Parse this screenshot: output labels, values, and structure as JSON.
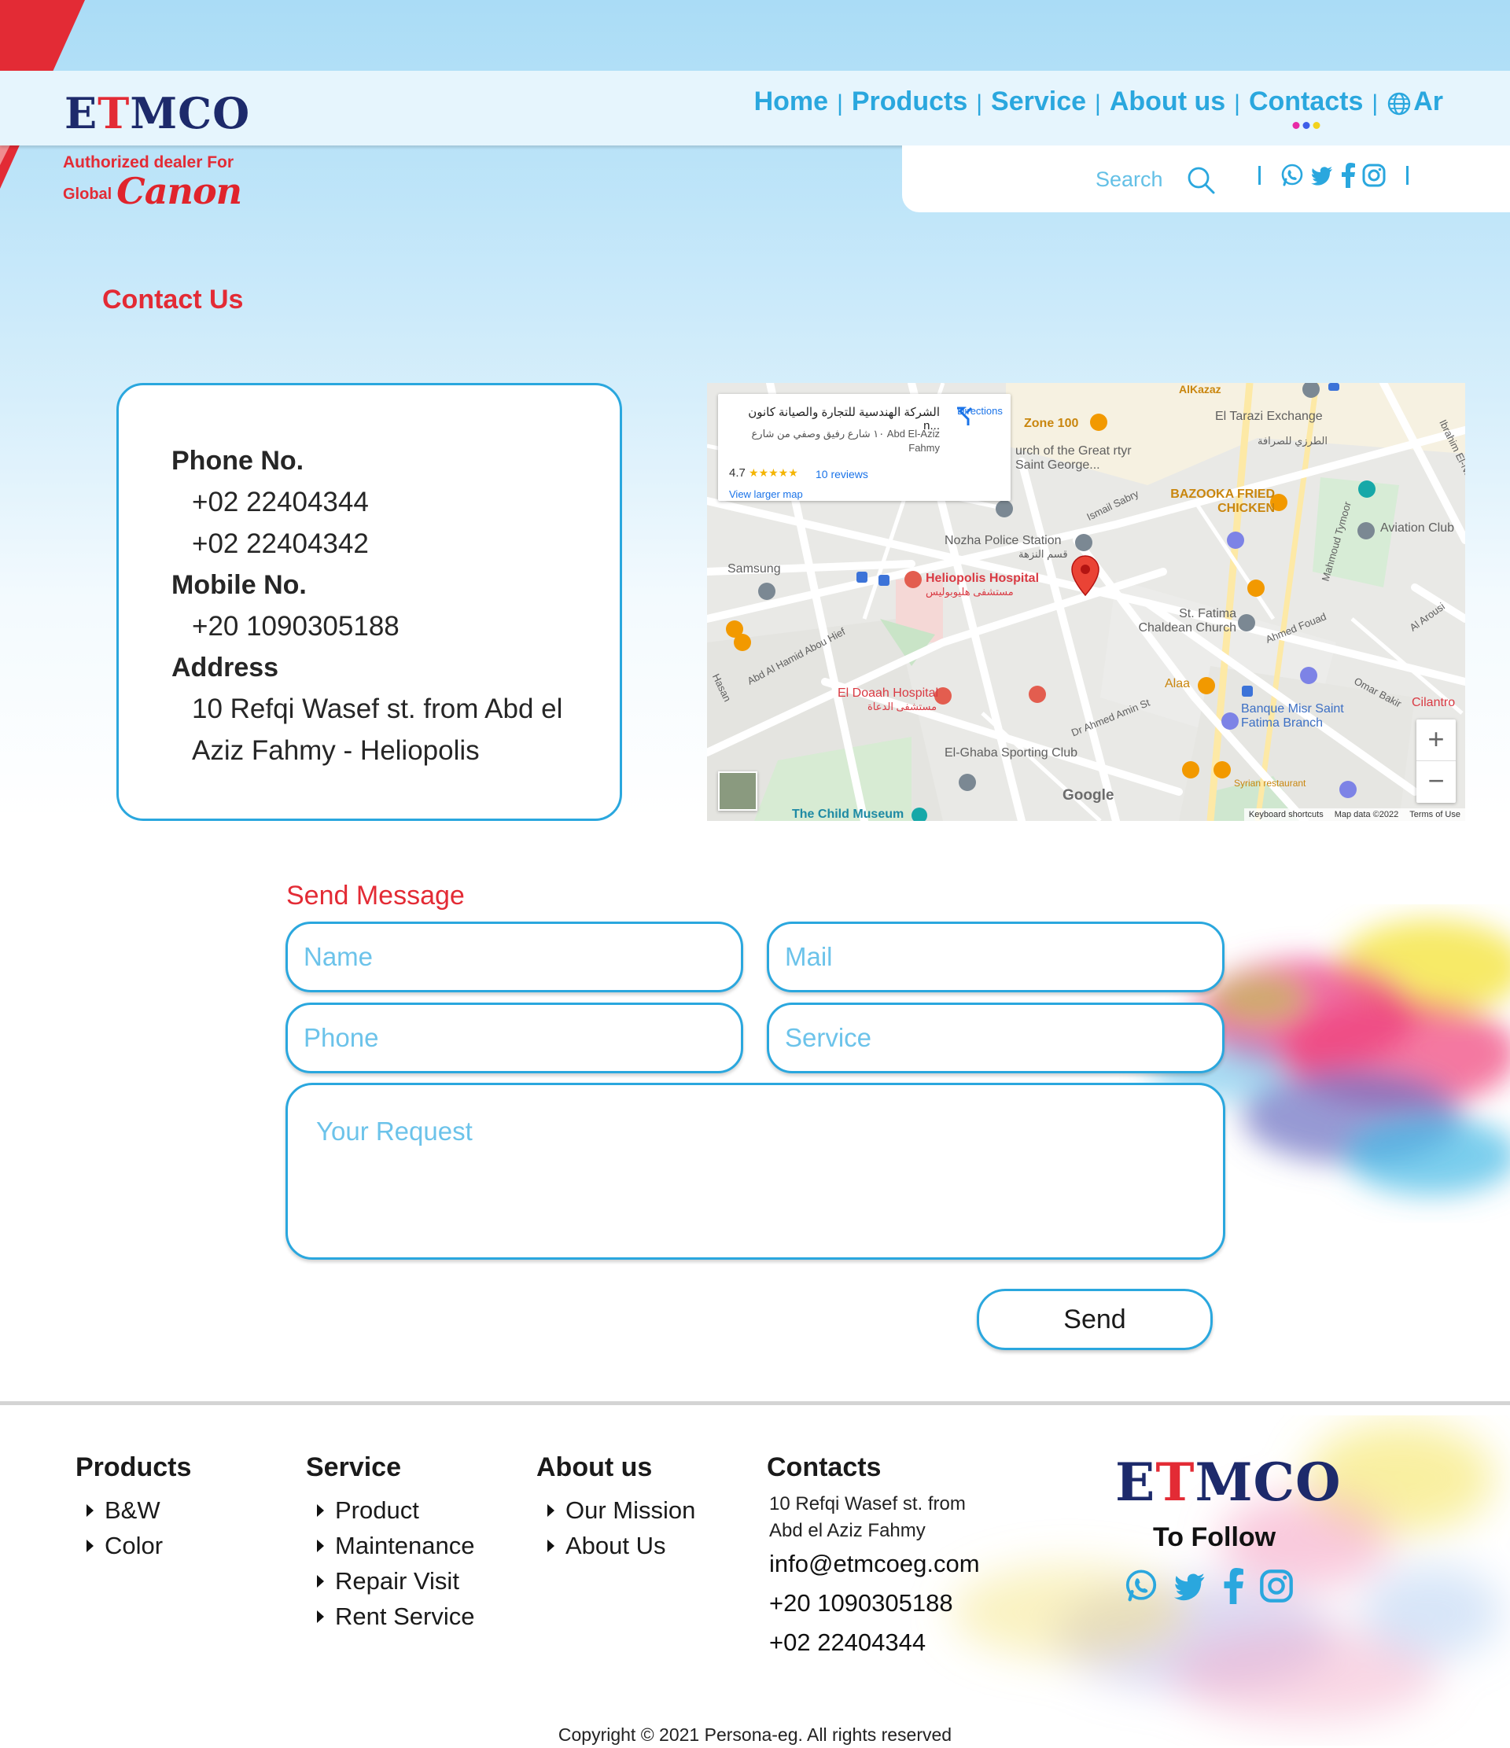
{
  "brand": {
    "logo_text_pre": "E",
    "logo_text_cross": "T",
    "logo_text_post": "MCO",
    "dealer_line": "Authorized dealer For",
    "dealer_global": "Global",
    "dealer_canon": "Canon",
    "accent_red": "#e32b35",
    "accent_blue": "#2aa7de",
    "navy": "#1d2a6b"
  },
  "nav": {
    "items": [
      {
        "label": "Home"
      },
      {
        "label": "Products"
      },
      {
        "label": "Service"
      },
      {
        "label": "About us"
      },
      {
        "label": "Contacts",
        "active": true
      }
    ],
    "separator": "|",
    "lang_label": "Ar",
    "lang_icon": "globe-icon",
    "search_label": "Search",
    "search_icon": "search-icon",
    "social_icons": [
      "whatsapp-icon",
      "twitter-icon",
      "facebook-icon",
      "instagram-icon"
    ],
    "active_dots": [
      "#e82aa6",
      "#3d5ee8",
      "#f2d21c"
    ]
  },
  "contact": {
    "title": "Contact Us",
    "phone_heading": "Phone No.",
    "phones": [
      "+02 22404344",
      "+02 22404342"
    ],
    "mobile_heading": "Mobile No.",
    "mobile": "+20 1090305188",
    "address_heading": "Address",
    "address": "10 Refqi Wasef st. from Abd el Aziz Fahmy - Heliopolis"
  },
  "map": {
    "place_name": "الشركة الهندسية للتجارة والصيانة كانون n...",
    "place_address": "١٠ شارع رفيق وصفي من شارع Abd El-Aziz Fahmy",
    "rating": "4.7",
    "stars": "★★★★★",
    "reviews": "10 reviews",
    "larger_map": "View larger map",
    "directions": "Directions",
    "zoom_in": "+",
    "zoom_out": "−",
    "google": "Google",
    "footer_links": [
      "Keyboard shortcuts",
      "Map data ©2022",
      "Terms of Use"
    ],
    "labels": {
      "zone": "Zone 100",
      "church_george": "urch of the Great rtyr Saint George...",
      "tarazi": "El Tarazi Exchange",
      "tarazi_ar": "الطرزي للصرافة",
      "bazooka": "BAZOOKA FRIED CHICKEN",
      "nozha": "Nozha Police Station",
      "nozha_ar": "قسم النزهة",
      "samsung": "Samsung",
      "heliopolis": "Heliopolis Hospital",
      "heliopolis_ar": "مستشفى هليوبوليس",
      "fatima": "St. Fatima Chaldean Church",
      "aviation": "Aviation Club",
      "doaah": "El Doaah Hospital",
      "doaah_ar": "مستشفى الدعاة",
      "alaa": "Alaa",
      "banque": "Banque Misr Saint Fatima Branch",
      "ghaba": "El-Ghaba Sporting Club",
      "child": "The Child Museum",
      "syrian": "Syrian restaurant",
      "cilantro": "Cilantro",
      "ismail": "Ismail Sabry",
      "ahmed_fouad": "Ahmed Fouad",
      "omar_bakir": "Omar Bakir",
      "ahmed_amin": "Dr Ahmed Amin St",
      "abou_hief": "Abd Al Hamid Abou Hief",
      "al_arousi": "Al Arousi",
      "mahmoud": "Mahmoud Tymoor",
      "ibrahim": "Ibrahim El-Naw",
      "hasan": "Hasan",
      "alkazaz": "AlKazaz"
    }
  },
  "form": {
    "title": "Send Message",
    "name_placeholder": "Name",
    "mail_placeholder": "Mail",
    "phone_placeholder": "Phone",
    "service_placeholder": "Service",
    "request_placeholder": "Your Request",
    "send_label": "Send"
  },
  "footer": {
    "products": {
      "heading": "Products",
      "items": [
        "B&W",
        "Color"
      ]
    },
    "service": {
      "heading": "Service",
      "items": [
        "Product",
        "Maintenance",
        "Repair Visit",
        "Rent Service"
      ]
    },
    "about": {
      "heading": "About us",
      "items": [
        "Our Mission",
        "About Us"
      ]
    },
    "contacts": {
      "heading": "Contacts",
      "address": "10 Refqi Wasef st. from Abd el Aziz Fahmy",
      "email": "info@etmcoeg.com",
      "mobile": "+20 1090305188",
      "phone": "+02 22404344"
    },
    "follow_label": "To Follow",
    "social_icons": [
      "whatsapp-icon",
      "twitter-icon",
      "facebook-icon",
      "instagram-icon"
    ],
    "copyright": "Copyright © 2021 Persona-eg. All rights reserved"
  }
}
